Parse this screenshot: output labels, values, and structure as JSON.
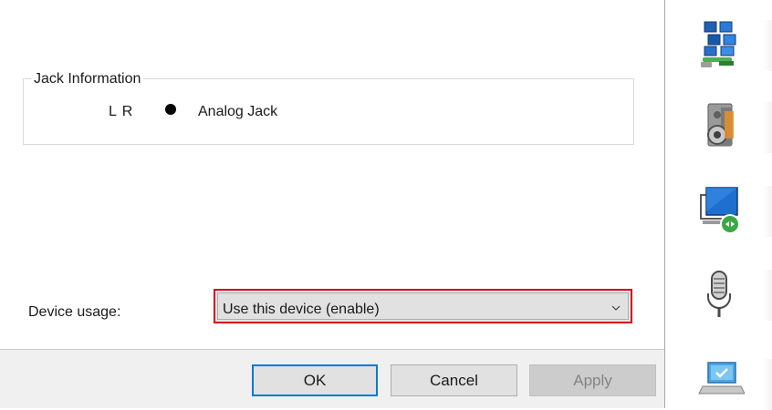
{
  "jack_information": {
    "group_title": "Jack Information",
    "channels": "L R",
    "jack_type": "Analog Jack"
  },
  "device_usage": {
    "label": "Device usage:",
    "selected_value": "Use this device (enable)"
  },
  "buttons": {
    "ok": "OK",
    "cancel": "Cancel",
    "apply": "Apply"
  },
  "side_icons": [
    "network-computers-icon",
    "sound-speaker-icon",
    "remote-desktop-icon",
    "microphone-icon",
    "laptop-check-icon"
  ],
  "colors": {
    "highlight_border": "#d9001b",
    "ok_focus_border": "#0078d7",
    "footer_background": "#f0f0f0",
    "button_background": "#e1e1e1"
  }
}
